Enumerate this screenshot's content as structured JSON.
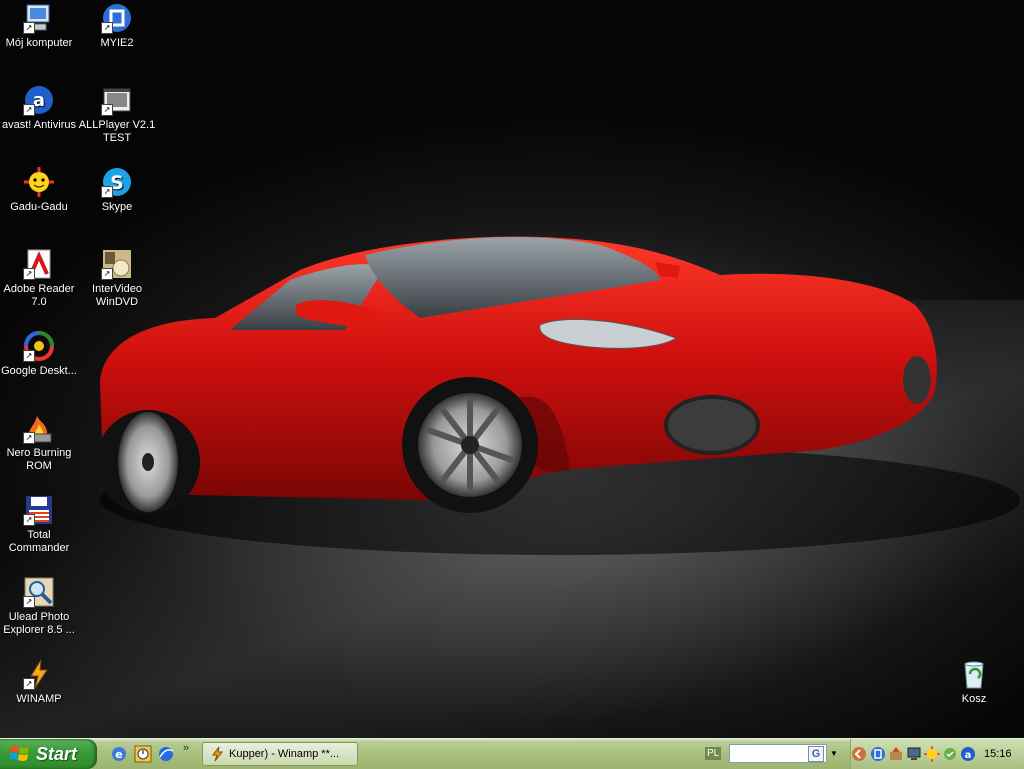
{
  "desktop": {
    "icons": [
      {
        "label": "Mój komputer",
        "icon": "my-computer-icon"
      },
      {
        "label": "MYIE2",
        "icon": "myie2-icon"
      },
      {
        "label": "avast! Antivirus",
        "icon": "avast-icon"
      },
      {
        "label": "ALLPlayer V2.1 TEST",
        "icon": "allplayer-icon"
      },
      {
        "label": "Gadu-Gadu",
        "icon": "gadu-gadu-icon"
      },
      {
        "label": "Skype",
        "icon": "skype-icon"
      },
      {
        "label": "Adobe Reader 7.0",
        "icon": "adobe-reader-icon"
      },
      {
        "label": "InterVideo WinDVD",
        "icon": "windvd-icon"
      },
      {
        "label": "Google Deskt...",
        "icon": "google-desktop-icon"
      },
      {
        "label": "Nero Burning ROM",
        "icon": "nero-icon"
      },
      {
        "label": "Total Commander",
        "icon": "total-commander-icon"
      },
      {
        "label": "Ulead Photo Explorer 8.5 ...",
        "icon": "ulead-icon"
      },
      {
        "label": "WINAMP",
        "icon": "winamp-icon"
      },
      {
        "label": "Kosz",
        "icon": "recycle-bin-icon"
      }
    ]
  },
  "taskbar": {
    "start_label": "Start",
    "overflow_label": "»",
    "task_label": "Kupper) - Winamp **...",
    "lang": "PL",
    "address_go": "G",
    "clock": "15:16"
  },
  "colors": {
    "car_red": "#d0100e",
    "taskbar_green": "#a9c07d",
    "start_green": "#3c9d39"
  }
}
